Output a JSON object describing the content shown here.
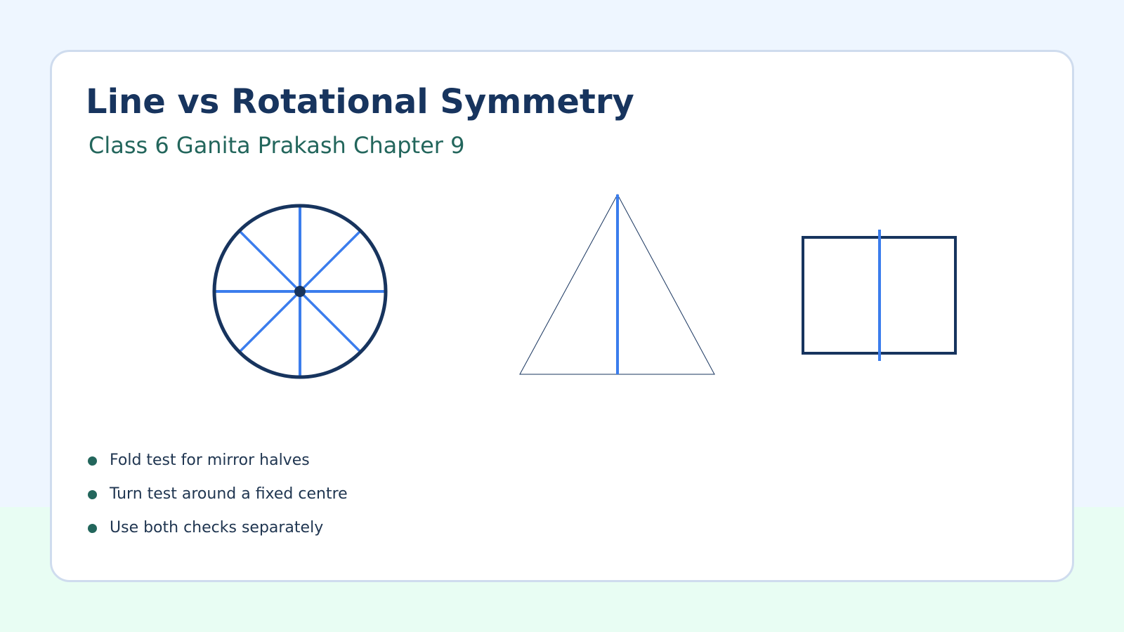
{
  "header": {
    "title": "Line vs Rotational Symmetry",
    "subtitle": "Class 6 Ganita Prakash Chapter 9"
  },
  "bullets": [
    {
      "text": "Fold test for mirror halves"
    },
    {
      "text": "Turn test around a fixed centre"
    },
    {
      "text": "Use both checks separately"
    }
  ],
  "colors": {
    "outline": "#17345e",
    "symmetry_line": "#3b7ded",
    "bullet": "#23665c",
    "title": "#17345e",
    "subtitle": "#23665c"
  }
}
